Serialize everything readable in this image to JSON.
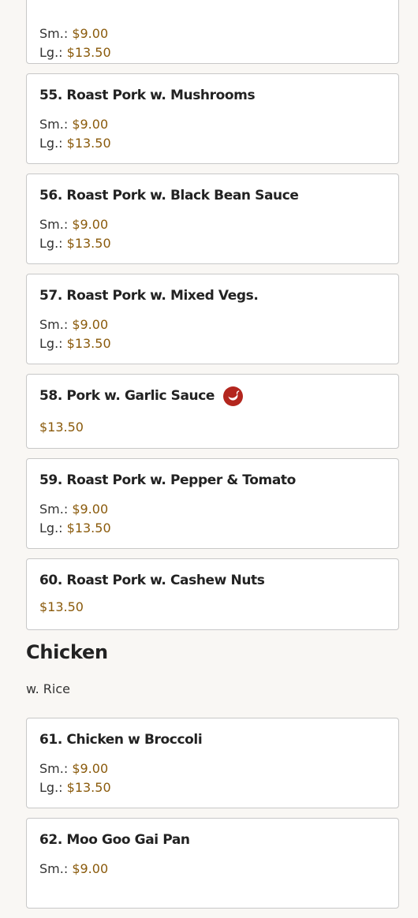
{
  "pork_items": [
    {
      "title": "",
      "small_label": "Sm.: ",
      "small_price": "$9.00",
      "large_label": "Lg.: ",
      "large_price": "$13.50"
    },
    {
      "title": "55. Roast Pork w. Mushrooms",
      "small_label": "Sm.: ",
      "small_price": "$9.00",
      "large_label": "Lg.: ",
      "large_price": "$13.50"
    },
    {
      "title": "56. Roast Pork w. Black Bean Sauce",
      "small_label": "Sm.: ",
      "small_price": "$9.00",
      "large_label": "Lg.: ",
      "large_price": "$13.50"
    },
    {
      "title": "57. Roast Pork w. Mixed Vegs.",
      "small_label": "Sm.: ",
      "small_price": "$9.00",
      "large_label": "Lg.: ",
      "large_price": "$13.50"
    },
    {
      "title": "58. Pork w. Garlic Sauce",
      "price": "$13.50",
      "icon": "spicy-icon"
    },
    {
      "title": "59. Roast Pork w. Pepper & Tomato",
      "small_label": "Sm.: ",
      "small_price": "$9.00",
      "large_label": "Lg.: ",
      "large_price": "$13.50"
    },
    {
      "title": "60. Roast Pork w. Cashew Nuts",
      "price": "$13.50"
    }
  ],
  "chicken_section": {
    "title": "Chicken",
    "subtitle": "w. Rice",
    "items": [
      {
        "title": "61. Chicken w Broccoli",
        "small_label": "Sm.: ",
        "small_price": "$9.00",
        "large_label": "Lg.: ",
        "large_price": "$13.50"
      },
      {
        "title": "62. Moo Goo Gai Pan",
        "small_label": "Sm.: ",
        "small_price": "$9.00"
      }
    ]
  },
  "colors": {
    "price": "#8a5a0b",
    "spicy_icon": "#b3261e",
    "card_border": "#c8c8c8",
    "background": "#f9f7f4"
  }
}
